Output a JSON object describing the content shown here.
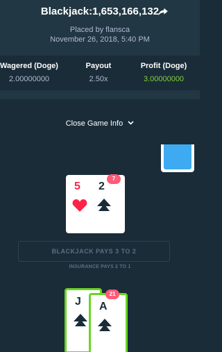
{
  "header": {
    "title": "Blackjack:1,653,166,132",
    "placed_by": "Placed by flansca",
    "date": "November 26, 2018, 5:40 PM",
    "share_icon": "share-arrow-icon"
  },
  "stats": [
    {
      "label": "Wagered (Doge)",
      "value": "2.00000000"
    },
    {
      "label": "Payout",
      "value": "2.50x"
    },
    {
      "label": "Profit (Doge)",
      "value": "3.00000000"
    }
  ],
  "toggle": {
    "label": "Close Game Info",
    "icon": "chevron-down-icon"
  },
  "dealer": {
    "score": "7",
    "cards": [
      {
        "rank": "5",
        "suit": "hearts"
      },
      {
        "rank": "2",
        "suit": "spades"
      }
    ]
  },
  "table": {
    "pays_text": "BLACKJACK PAYS 3 TO 2",
    "insurance_text": "INSURANCE PAYS 2 TO 1"
  },
  "player": {
    "score": "21",
    "cards": [
      {
        "rank": "J",
        "suit": "spades"
      },
      {
        "rank": "A",
        "suit": "spades"
      }
    ]
  },
  "colors": {
    "background": "#1a2c38",
    "header": "#213743",
    "profit": "#7fd23c",
    "hearts": "#fe2247",
    "win_border": "#6ad522",
    "badge": "#fe5b76",
    "card_back": "#3eaaf1"
  }
}
